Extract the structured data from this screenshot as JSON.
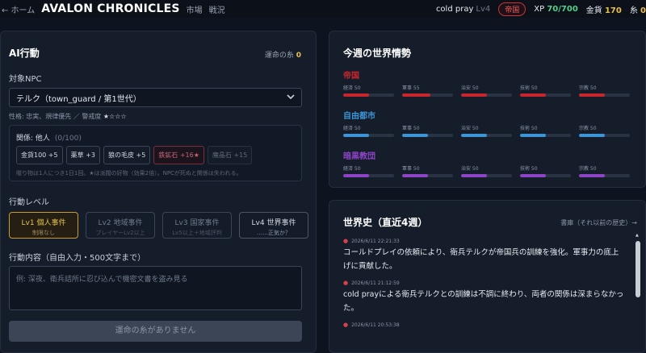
{
  "topbar": {
    "home": "← ホーム",
    "brand": "AVALON CHRONICLES",
    "nav": [
      "市場",
      "戦況"
    ],
    "user": "cold pray",
    "level": "Lv4",
    "faction_badge": "帝国",
    "xp_label": "XP",
    "xp_value": "70/700",
    "gold_label": "金貨",
    "gold_value": "170",
    "thread_label": "糸",
    "thread_value": "0"
  },
  "ai_action": {
    "title": "AI行動",
    "fate_label": "運命の糸",
    "fate_value": "0",
    "target_label": "対象NPC",
    "npc_select": "テルク（town_guard / 第1世代）",
    "npc_info": "性格: 忠実、規律優先 ／ 警戒度",
    "npc_stars": "★☆☆☆",
    "relation_label": "関係: 他人",
    "relation_count": "(0/100)",
    "gifts": [
      "金貨100 +5",
      "薬草 +3",
      "狼の毛皮 +5",
      "鉄鉱石 +16★",
      "魔晶石 +15"
    ],
    "gift_note": "贈り物は1人につき1日1回。★は派閥の好物（効果2倍）。NPCが死ぬと関係は失われる。",
    "level_label": "行動レベル",
    "levels": [
      {
        "title": "Lv1 個人事件",
        "sub": "制限なし"
      },
      {
        "title": "Lv2 地域事件",
        "sub": "プレイヤーLv2以上"
      },
      {
        "title": "Lv3 国家事件",
        "sub": "Lv5以上＋地域評判"
      },
      {
        "title": "Lv4 世界事件",
        "sub": "……正気か？"
      }
    ],
    "content_label": "行動内容（自由入力・500文字まで）",
    "content_placeholder": "例: 深夜、衛兵詰所に忍び込んで機密文書を盗み見る",
    "submit": "運命の糸がありません"
  },
  "world": {
    "title": "今週の世界情勢",
    "factions": [
      {
        "name": "帝国",
        "color": "#c8262c",
        "stats": [
          {
            "label": "経済 50",
            "value": 50
          },
          {
            "label": "軍事 55",
            "value": 55
          },
          {
            "label": "治安 50",
            "value": 50
          },
          {
            "label": "技術 50",
            "value": 50
          },
          {
            "label": "宗教 50",
            "value": 50
          }
        ]
      },
      {
        "name": "自由都市",
        "color": "#3b95d6",
        "stats": [
          {
            "label": "経済 50",
            "value": 50
          },
          {
            "label": "軍事 50",
            "value": 50
          },
          {
            "label": "治安 50",
            "value": 50
          },
          {
            "label": "技術 50",
            "value": 50
          },
          {
            "label": "宗教 50",
            "value": 50
          }
        ]
      },
      {
        "name": "暗黒教団",
        "color": "#8e44c7",
        "stats": [
          {
            "label": "経済 50",
            "value": 50
          },
          {
            "label": "軍事 50",
            "value": 50
          },
          {
            "label": "治安 50",
            "value": 50
          },
          {
            "label": "技術 50",
            "value": 50
          },
          {
            "label": "宗教 50",
            "value": 50
          }
        ]
      }
    ]
  },
  "history": {
    "title": "世界史（直近4週）",
    "archive_link": "書庫（それ以前の歴史）→",
    "entries": [
      {
        "time": "2026/6/11 22:21:33",
        "text": "コールドプレイの依頼により、衛兵テルクが帝国兵の訓練を強化。軍事力の底上げに貢献した。"
      },
      {
        "time": "2026/6/11 21:12:59",
        "text": "cold prayによる衛兵テルクとの訓練は不調に終わり、両者の関係は深まらなかった。"
      },
      {
        "time": "2026/6/11 20:53:38",
        "text": ""
      }
    ]
  }
}
